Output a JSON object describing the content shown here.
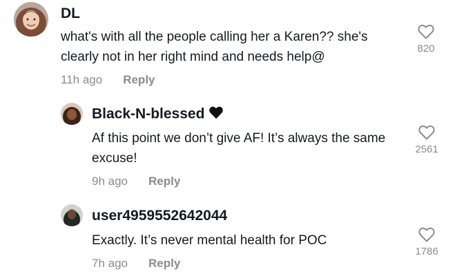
{
  "comments": [
    {
      "username": "DL",
      "text": "what's with all the people calling her a Karen?? she's clearly not in her right mind and needs help@",
      "time": "11h ago",
      "reply_label": "Reply",
      "likes": "820",
      "avatar_icon": "user-avatar-photo"
    },
    {
      "username": "Black-N-blessed",
      "username_emoji": "black-heart-icon",
      "text": "Af this point we don’t give AF! It’s always the same excuse!",
      "time": "9h ago",
      "reply_label": "Reply",
      "likes": "2561",
      "avatar_icon": "user-avatar-photo"
    },
    {
      "username": "user4959552642044",
      "text": "Exactly. It’s never mental health for POC",
      "time": "7h ago",
      "reply_label": "Reply",
      "likes": "1786",
      "avatar_icon": "user-avatar-photo"
    }
  ],
  "colors": {
    "primary_text": "#161823",
    "secondary_text": "#8a8b91"
  }
}
